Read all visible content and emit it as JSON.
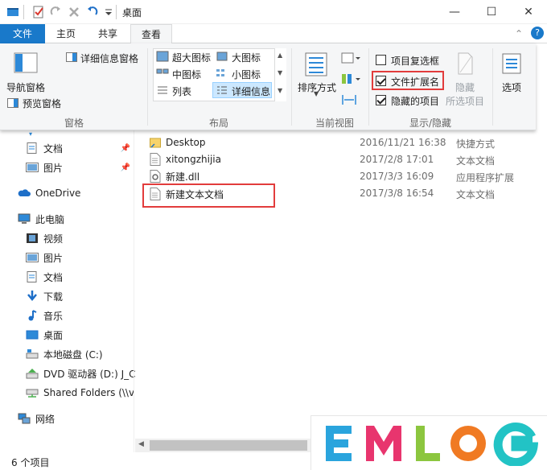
{
  "window": {
    "title": "桌面"
  },
  "window_controls": {
    "minimize": "—",
    "maximize": "☐",
    "close": "✕"
  },
  "tabs": [
    {
      "label": "文件",
      "active": false
    },
    {
      "label": "主页",
      "active": false
    },
    {
      "label": "共享",
      "active": false
    },
    {
      "label": "查看",
      "active": true
    }
  ],
  "help_icon": "?",
  "expand_icon": "⌃",
  "ribbon": {
    "panes": {
      "navigation_pane": "导航窗格",
      "preview_pane": "预览窗格",
      "details_pane": "详细信息窗格",
      "group_label": "窗格"
    },
    "layout": {
      "items": [
        "超大图标",
        "大图标",
        "中图标",
        "小图标",
        "列表",
        "详细信息"
      ],
      "selected": "详细信息",
      "group_label": "布局"
    },
    "current_view": {
      "sort_by": "排序方式",
      "group_label": "当前视图"
    },
    "show_hide": {
      "item_checkboxes": {
        "label": "项目复选框",
        "checked": false
      },
      "file_extensions": {
        "label": "文件扩展名",
        "checked": true
      },
      "hidden_items": {
        "label": "隐藏的项目",
        "checked": true
      },
      "hide_selected_line1": "隐藏",
      "hide_selected_line2": "所选项目",
      "group_label": "显示/隐藏"
    },
    "options": {
      "label": "选项"
    }
  },
  "nav": {
    "items": [
      {
        "label": "文档",
        "icon": "document-icon",
        "pinned": true
      },
      {
        "label": "图片",
        "icon": "picture-icon",
        "pinned": true
      },
      {
        "label": "OneDrive",
        "icon": "onedrive-icon"
      },
      {
        "label": "此电脑",
        "icon": "computer-icon"
      },
      {
        "label": "视频",
        "icon": "video-icon"
      },
      {
        "label": "图片",
        "icon": "picture-icon"
      },
      {
        "label": "文档",
        "icon": "document-icon"
      },
      {
        "label": "下载",
        "icon": "download-icon"
      },
      {
        "label": "音乐",
        "icon": "music-icon"
      },
      {
        "label": "桌面",
        "icon": "desktop-icon"
      },
      {
        "label": "本地磁盘 (C:)",
        "icon": "drive-icon"
      },
      {
        "label": "DVD 驱动器 (D:) J_C",
        "icon": "dvd-icon"
      },
      {
        "label": "Shared Folders (\\\\v",
        "icon": "network-drive-icon"
      },
      {
        "label": "网络",
        "icon": "network-icon"
      }
    ]
  },
  "files": [
    {
      "name": "Desktop",
      "date": "2016/11/21 16:38",
      "type": "快捷方式",
      "icon": "folder-shortcut-icon"
    },
    {
      "name": "xitongzhijia",
      "date": "2017/2/8 17:01",
      "type": "文本文档",
      "icon": "text-file-icon"
    },
    {
      "name": "新建.dll",
      "date": "2017/3/3 16:09",
      "type": "应用程序扩展",
      "icon": "dll-file-icon"
    },
    {
      "name": "新建文本文档",
      "date": "2017/3/8 16:54",
      "type": "文本文档",
      "icon": "text-file-icon"
    }
  ],
  "status": {
    "item_count": "6 个项目"
  },
  "logo": {
    "letters": [
      "E",
      "M",
      "L",
      "O",
      "G"
    ],
    "colors": [
      "#2aa4dd",
      "#e8356e",
      "#8cc63f",
      "#f07a23",
      "#22c3c5"
    ]
  },
  "colors": {
    "accent": "#1979ca",
    "highlight_box": "#e23c3c"
  }
}
